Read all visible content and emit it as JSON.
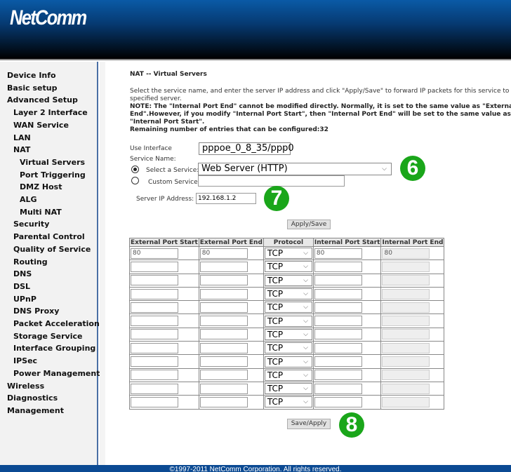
{
  "header": {
    "logo": "NetComm"
  },
  "sidebar": {
    "items": [
      {
        "label": "Device Info",
        "level": 0
      },
      {
        "label": "Basic setup",
        "level": 0
      },
      {
        "label": "Advanced Setup",
        "level": 0
      },
      {
        "label": "Layer 2 Interface",
        "level": 1
      },
      {
        "label": "WAN Service",
        "level": 1
      },
      {
        "label": "LAN",
        "level": 1
      },
      {
        "label": "NAT",
        "level": 1
      },
      {
        "label": "Virtual Servers",
        "level": 2
      },
      {
        "label": "Port Triggering",
        "level": 2
      },
      {
        "label": "DMZ Host",
        "level": 2
      },
      {
        "label": "ALG",
        "level": 2
      },
      {
        "label": "Multi NAT",
        "level": 2
      },
      {
        "label": "Security",
        "level": 1
      },
      {
        "label": "Parental Control",
        "level": 1
      },
      {
        "label": "Quality of Service",
        "level": 1
      },
      {
        "label": "Routing",
        "level": 1
      },
      {
        "label": "DNS",
        "level": 1
      },
      {
        "label": "DSL",
        "level": 1
      },
      {
        "label": "UPnP",
        "level": 1
      },
      {
        "label": "DNS Proxy",
        "level": 1
      },
      {
        "label": "Packet Acceleration",
        "level": 1
      },
      {
        "label": "Storage Service",
        "level": 1
      },
      {
        "label": "Interface Grouping",
        "level": 1
      },
      {
        "label": "IPSec",
        "level": 1
      },
      {
        "label": "Power Management",
        "level": 1
      },
      {
        "label": "Wireless",
        "level": 0
      },
      {
        "label": "Diagnostics",
        "level": 0
      },
      {
        "label": "Management",
        "level": 0
      }
    ]
  },
  "main": {
    "title": "NAT -- Virtual Servers",
    "desc1": "Select the service name, and enter the server IP address and click \"Apply/Save\" to forward IP packets for this service to the",
    "desc2": "specified server.",
    "note1": "NOTE: The \"Internal Port End\" cannot be modified directly. Normally, it is set to the same value as \"External Port",
    "note2": "End\".However, if you modify \"Internal Port Start\", then \"Internal Port End\" will be set to the same value as",
    "note3": "\"Internal Port Start\".",
    "remaining": "Remaining number of entries that can be configured:32",
    "use_interface_label": "Use Interface",
    "use_interface_value": "pppoe_0_8_35/ppp0",
    "service_name_label": "Service Name:",
    "select_service_label": "Select a Service:",
    "select_service_value": "Web Server (HTTP)",
    "select_service_checked": true,
    "custom_service_label": "Custom Service:",
    "custom_service_value": "",
    "server_ip_label": "Server IP Address:",
    "server_ip_value": "192.168.1.2",
    "apply_save": "Apply/Save",
    "save_apply": "Save/Apply",
    "columns": [
      "External Port Start",
      "External Port End",
      "Protocol",
      "Internal Port Start",
      "Internal Port End"
    ],
    "rows": [
      [
        "80",
        "80",
        "TCP",
        "80",
        "80"
      ],
      [
        "",
        "",
        "TCP",
        "",
        ""
      ],
      [
        "",
        "",
        "TCP",
        "",
        ""
      ],
      [
        "",
        "",
        "TCP",
        "",
        ""
      ],
      [
        "",
        "",
        "TCP",
        "",
        ""
      ],
      [
        "",
        "",
        "TCP",
        "",
        ""
      ],
      [
        "",
        "",
        "TCP",
        "",
        ""
      ],
      [
        "",
        "",
        "TCP",
        "",
        ""
      ],
      [
        "",
        "",
        "TCP",
        "",
        ""
      ],
      [
        "",
        "",
        "TCP",
        "",
        ""
      ],
      [
        "",
        "",
        "TCP",
        "",
        ""
      ],
      [
        "",
        "",
        "TCP",
        "",
        ""
      ]
    ]
  },
  "annotations": [
    "6",
    "7",
    "8"
  ],
  "footer": {
    "copyright": "©1997-2011 NetComm Corporation. All rights reserved."
  },
  "colors": {
    "header_top": "#0a5aa6",
    "footer": "#0b4a93",
    "badge": "#1aa61a",
    "sidebar": "#f2f2f2"
  }
}
